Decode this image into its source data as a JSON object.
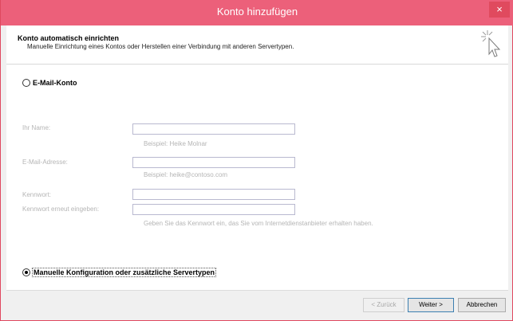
{
  "window": {
    "title": "Konto hinzufügen",
    "close_glyph": "×"
  },
  "header": {
    "title": "Konto automatisch einrichten",
    "subtitle": "Manuelle Einrichtung eines Kontos oder Herstellen einer Verbindung mit anderen Servertypen.",
    "icon": "wizard-cursor-icon"
  },
  "options": {
    "email_account": {
      "label": "E-Mail-Konto",
      "selected": false
    },
    "manual": {
      "label": "Manuelle Konfiguration oder zusätzliche Servertypen",
      "selected": true
    }
  },
  "form": {
    "name_label": "Ihr Name:",
    "name_value": "",
    "name_hint": "Beispiel: Heike Molnar",
    "email_label": "E-Mail-Adresse:",
    "email_value": "",
    "email_hint": "Beispiel: heike@contoso.com",
    "password_label": "Kennwort:",
    "password_repeat_label": "Kennwort erneut eingeben:",
    "password_hint": "Geben Sie das Kennwort ein, das Sie vom Internetdienstanbieter erhalten haben."
  },
  "footer": {
    "back_label": "< Zurück",
    "next_label": "Weiter >",
    "cancel_label": "Abbrechen"
  },
  "colors": {
    "titlebar": "#ec607a",
    "close": "#e04a5e"
  }
}
